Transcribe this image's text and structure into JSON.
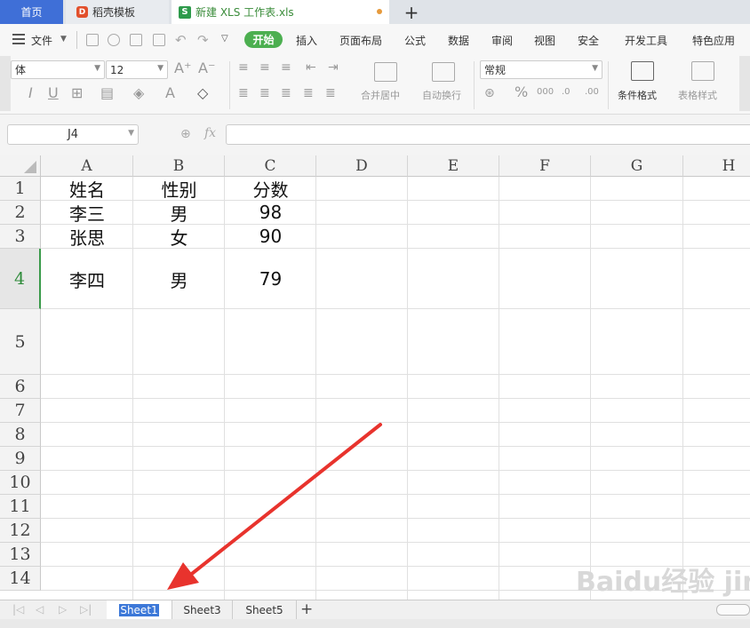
{
  "tabs": {
    "home": "首页",
    "template": "稻壳模板",
    "template_logo": "D",
    "file": "新建 XLS 工作表.xls",
    "file_logo": "S",
    "add": "+"
  },
  "menu": {
    "file": "文件",
    "items": [
      "开始",
      "插入",
      "页面布局",
      "公式",
      "数据",
      "审阅",
      "视图",
      "安全",
      "开发工具",
      "特色应用"
    ]
  },
  "ribbon": {
    "font_name": "体",
    "font_size": "12",
    "number_format": "常规",
    "merge_center": "合并居中",
    "wrap_text": "自动换行",
    "conditional_format": "条件格式",
    "table_style": "表格样式"
  },
  "formula_bar": {
    "name_box": "J4",
    "fx": "fx"
  },
  "grid": {
    "columns": [
      "A",
      "B",
      "C",
      "D",
      "E",
      "F",
      "G",
      "H"
    ],
    "rows": [
      "1",
      "2",
      "3",
      "4",
      "5",
      "6",
      "7",
      "8",
      "9",
      "10",
      "11",
      "12",
      "13",
      "14"
    ],
    "cells": [
      [
        "姓名",
        "性别",
        "分数"
      ],
      [
        "李三",
        "男",
        "98"
      ],
      [
        "张思",
        "女",
        "90"
      ],
      [
        "李四",
        "男",
        "79"
      ]
    ]
  },
  "sheets": {
    "tabs": [
      "Sheet1",
      "Sheet3",
      "Sheet5"
    ],
    "add": "+"
  },
  "watermark": "Baidu经验 jingyan.baidu.com",
  "colors": {
    "accent_blue": "#3f6fd7",
    "start_green": "#4caf50",
    "arrow_red": "#e8332d"
  }
}
